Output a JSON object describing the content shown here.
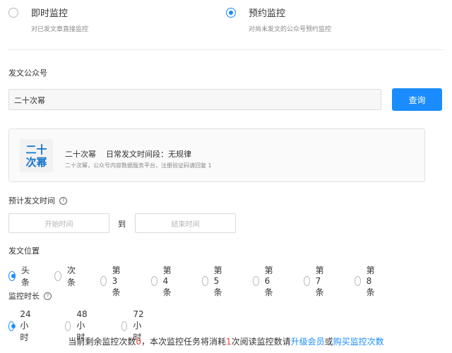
{
  "monitor_modes": [
    {
      "title": "即时监控",
      "desc": "对已发文章直接监控",
      "checked": false
    },
    {
      "title": "预约监控",
      "desc": "对尚未发文的公众号预约监控",
      "checked": true
    }
  ],
  "account_section": {
    "label": "发文公众号",
    "input_value": "二十次幂",
    "query_label": "查询"
  },
  "account_card": {
    "avatar_line1": "二十",
    "avatar_line2": "次幂",
    "name": "二十次幂",
    "schedule": "日常发文时间段：无规律",
    "intro": "二十次幂，公众号内容数据服务平台，注册验证码请回复 1"
  },
  "publish_time": {
    "label": "预计发文时间",
    "start_placeholder": "开始时间",
    "to_label": "到",
    "end_placeholder": "结束时间"
  },
  "position": {
    "label": "发文位置",
    "options": [
      "头条",
      "次条",
      "第3条",
      "第4条",
      "第5条",
      "第6条",
      "第7条",
      "第8条"
    ],
    "selected": "头条"
  },
  "duration": {
    "label": "监控时长",
    "options": [
      "24小时",
      "48小时",
      "72小时"
    ],
    "selected": "24小时"
  },
  "footer": {
    "t1": "当前剩余监控次数",
    "remaining": "0",
    "t2": "，本次监控任务将消耗",
    "cost": "1",
    "t3": "次阅读监控数请",
    "upgrade_link": "升级会员",
    "or": "或",
    "buy_link": "购买监控次数"
  },
  "colors": {
    "accent": "#1a8cff",
    "warning": "#f04134"
  }
}
